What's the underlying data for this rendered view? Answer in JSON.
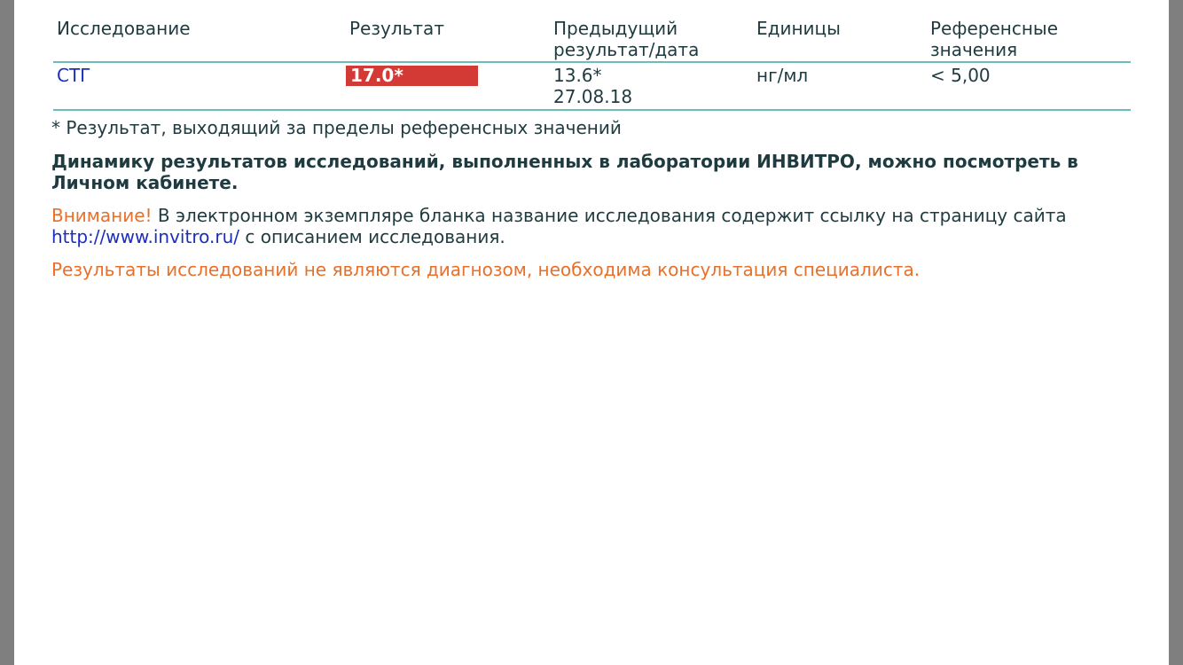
{
  "table": {
    "headers": {
      "test": "Исследование",
      "result": "Результат",
      "previous_line1": "Предыдущий",
      "previous_line2": "результат/дата",
      "units": "Единицы",
      "reference_line1": "Референсные",
      "reference_line2": "значения"
    },
    "rows": [
      {
        "test": "СТГ",
        "result": "17.0*",
        "previous_value": "13.6*",
        "previous_date": "27.08.18",
        "units": "нг/мл",
        "reference": "< 5,00"
      }
    ]
  },
  "footnote": "* Результат, выходящий за пределы референсных значений",
  "dynamics_note": "Динамику результатов исследований, выполненных в лаборатории ИНВИТРО, можно посмотреть в Личном кабинете.",
  "attention": {
    "label": "Внимание!",
    "text": " В электронном экземпляре бланка название исследования содержит ссылку на страницу сайта",
    "link": "http://www.invitro.ru/",
    "text_after": " с описанием исследования."
  },
  "disclaimer": "Результаты исследований не являются диагнозом, необходима консультация специалиста.",
  "colors": {
    "background": "#7f7f7f",
    "text": "#1f3b40",
    "link": "#1a2fbf",
    "table_rule": "#6bbcbc",
    "abnormal_result": "#d33a35",
    "warning": "#e8702a"
  }
}
